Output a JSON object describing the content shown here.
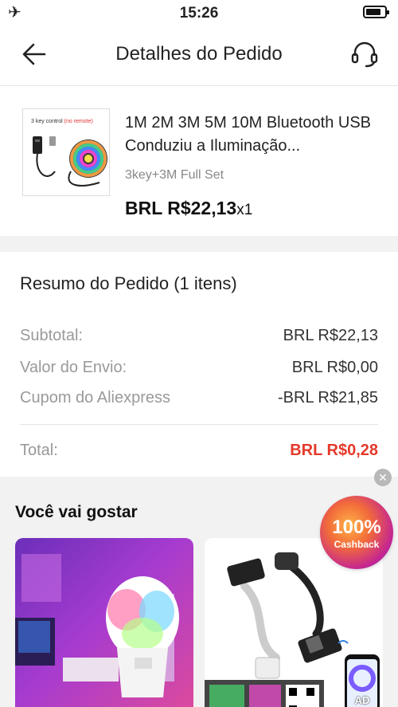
{
  "status_bar": {
    "time": "15:26"
  },
  "nav": {
    "title": "Detalhes do Pedido"
  },
  "product": {
    "name": "1M 2M 3M 5M 10M Bluetooth USB Conduziu a Iluminação...",
    "variant": "3key+3M Full Set",
    "price": "BRL R$22,13",
    "quantity": "x1",
    "thumb_caption": "3 key control",
    "thumb_caption_note": "(no remote)"
  },
  "summary": {
    "heading": "Resumo do Pedido (1 itens)",
    "rows": [
      {
        "label": "Subtotal:",
        "value": "BRL R$22,13"
      },
      {
        "label": "Valor do Envio:",
        "value": "BRL R$0,00"
      },
      {
        "label": "Cupom do Aliexpress",
        "value": "-BRL R$21,85"
      }
    ],
    "total_label": "Total:",
    "total_value": "BRL R$0,28"
  },
  "recommendations": {
    "heading": "Você vai gostar",
    "cashback_percent": "100%",
    "cashback_label": "Cashback",
    "ad_label": "AD"
  },
  "colors": {
    "accent_total": "#e4392b",
    "variant_gray": "#888888"
  }
}
